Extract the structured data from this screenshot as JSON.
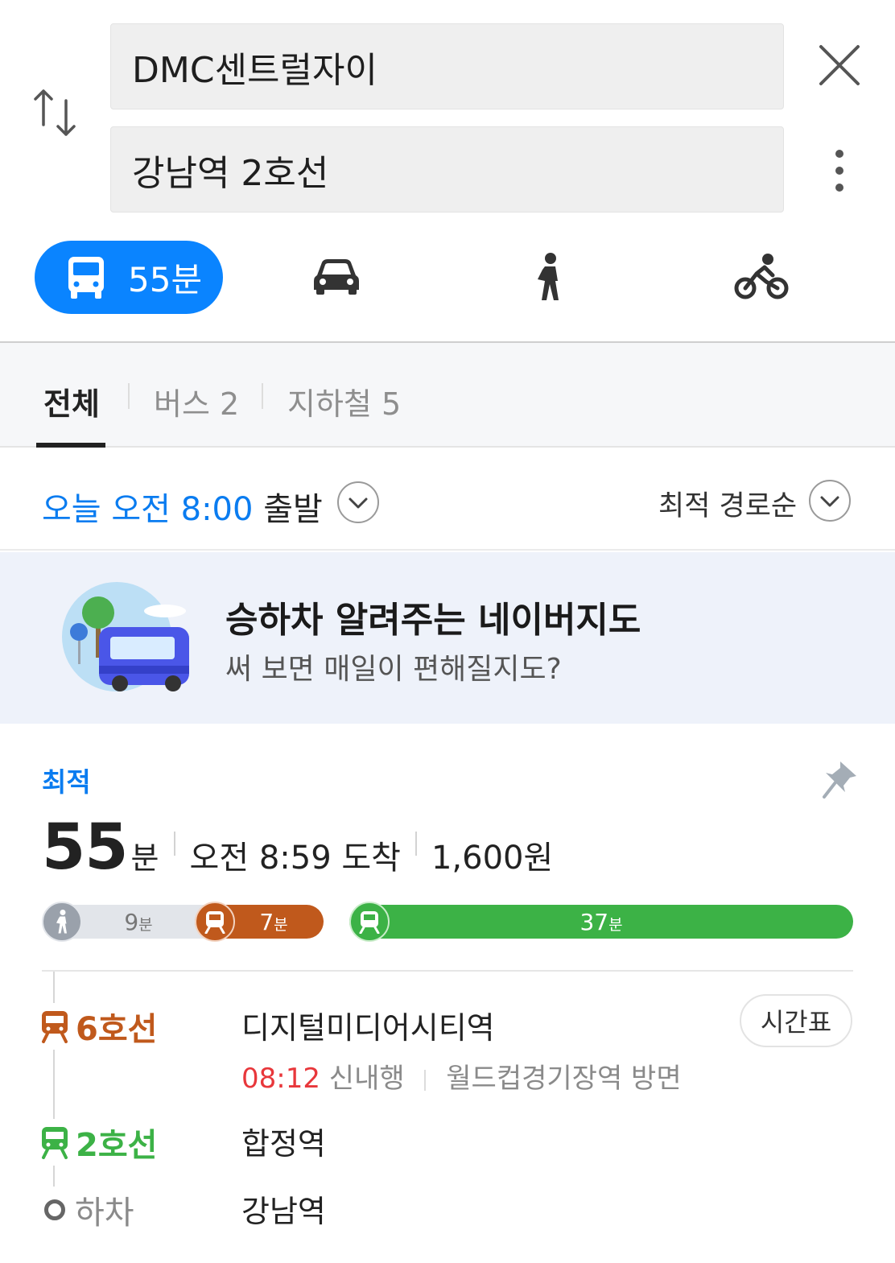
{
  "search": {
    "origin": "DMC센트럴자이",
    "destination": "강남역 2호선"
  },
  "modes": {
    "transit_time": "55분"
  },
  "tabs": {
    "all": "전체",
    "bus": "버스 2",
    "subway": "지하철 5"
  },
  "departure": {
    "prefix": "오늘 오전 8:00",
    "suffix": "출발"
  },
  "sort": {
    "label": "최적 경로순"
  },
  "banner": {
    "title": "승하차 알려주는 네이버지도",
    "subtitle": "써 보면 매일이 편해질지도?"
  },
  "route": {
    "tag": "최적",
    "duration_num": "55",
    "duration_unit": "분",
    "arrival": "오전 8:59 도착",
    "fare": "1,600원",
    "segments": [
      {
        "num": "9",
        "unit": "분"
      },
      {
        "num": "7",
        "unit": "분"
      },
      {
        "num": "37",
        "unit": "분"
      }
    ],
    "steps": [
      {
        "line": "6호선",
        "station": "디지털미디어시티역"
      },
      {
        "line": "2호선",
        "station": "합정역"
      },
      {
        "line": "하차",
        "station": "강남역"
      }
    ],
    "first_detail": {
      "time": "08:12",
      "direction": "신내행",
      "platform": "월드컵경기장역 방면"
    },
    "timetable_label": "시간표"
  },
  "colors": {
    "accent_blue": "#0a84ff",
    "line6": "#c0591c",
    "line2": "#3cb246",
    "time_red": "#e8373b"
  }
}
